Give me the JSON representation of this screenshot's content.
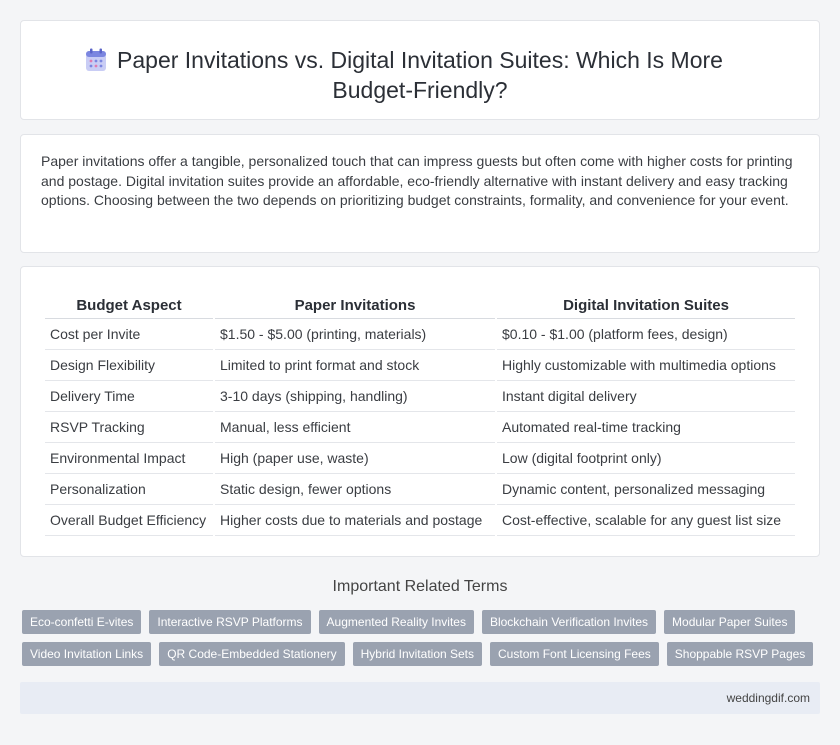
{
  "header": {
    "icon": "calendar-icon",
    "title": "Paper Invitations vs. Digital Invitation Suites: Which Is More Budget-Friendly?"
  },
  "intro": "Paper invitations offer a tangible, personalized touch that can impress guests but often come with higher costs for printing and postage. Digital invitation suites provide an affordable, eco-friendly alternative with instant delivery and easy tracking options. Choosing between the two depends on prioritizing budget constraints, formality, and convenience for your event.",
  "table": {
    "headers": [
      "Budget Aspect",
      "Paper Invitations",
      "Digital Invitation Suites"
    ],
    "rows": [
      [
        "Cost per Invite",
        "$1.50 - $5.00 (printing, materials)",
        "$0.10 - $1.00 (platform fees, design)"
      ],
      [
        "Design Flexibility",
        "Limited to print format and stock",
        "Highly customizable with multimedia options"
      ],
      [
        "Delivery Time",
        "3-10 days (shipping, handling)",
        "Instant digital delivery"
      ],
      [
        "RSVP Tracking",
        "Manual, less efficient",
        "Automated real-time tracking"
      ],
      [
        "Environmental Impact",
        "High (paper use, waste)",
        "Low (digital footprint only)"
      ],
      [
        "Personalization",
        "Static design, fewer options",
        "Dynamic content, personalized messaging"
      ],
      [
        "Overall Budget Efficiency",
        "Higher costs due to materials and postage",
        "Cost-effective, scalable for any guest list size"
      ]
    ]
  },
  "related": {
    "title": "Important Related Terms",
    "tags_row1": [
      "Eco-confetti E-vites",
      "Interactive RSVP Platforms",
      "Augmented Reality Invites",
      "Blockchain Verification Invites",
      "Modular Paper Suites"
    ],
    "tags_row2": [
      "Video Invitation Links",
      "QR Code-Embedded Stationery",
      "Hybrid Invitation Sets",
      "Custom Font Licensing Fees",
      "Shoppable RSVP Pages"
    ]
  },
  "footer": {
    "site": "weddingdif.com"
  },
  "colors": {
    "tag_bg": "#9aa2b0",
    "footer_bg": "#e8ecf4",
    "icon_accent": "#7b86e0"
  }
}
